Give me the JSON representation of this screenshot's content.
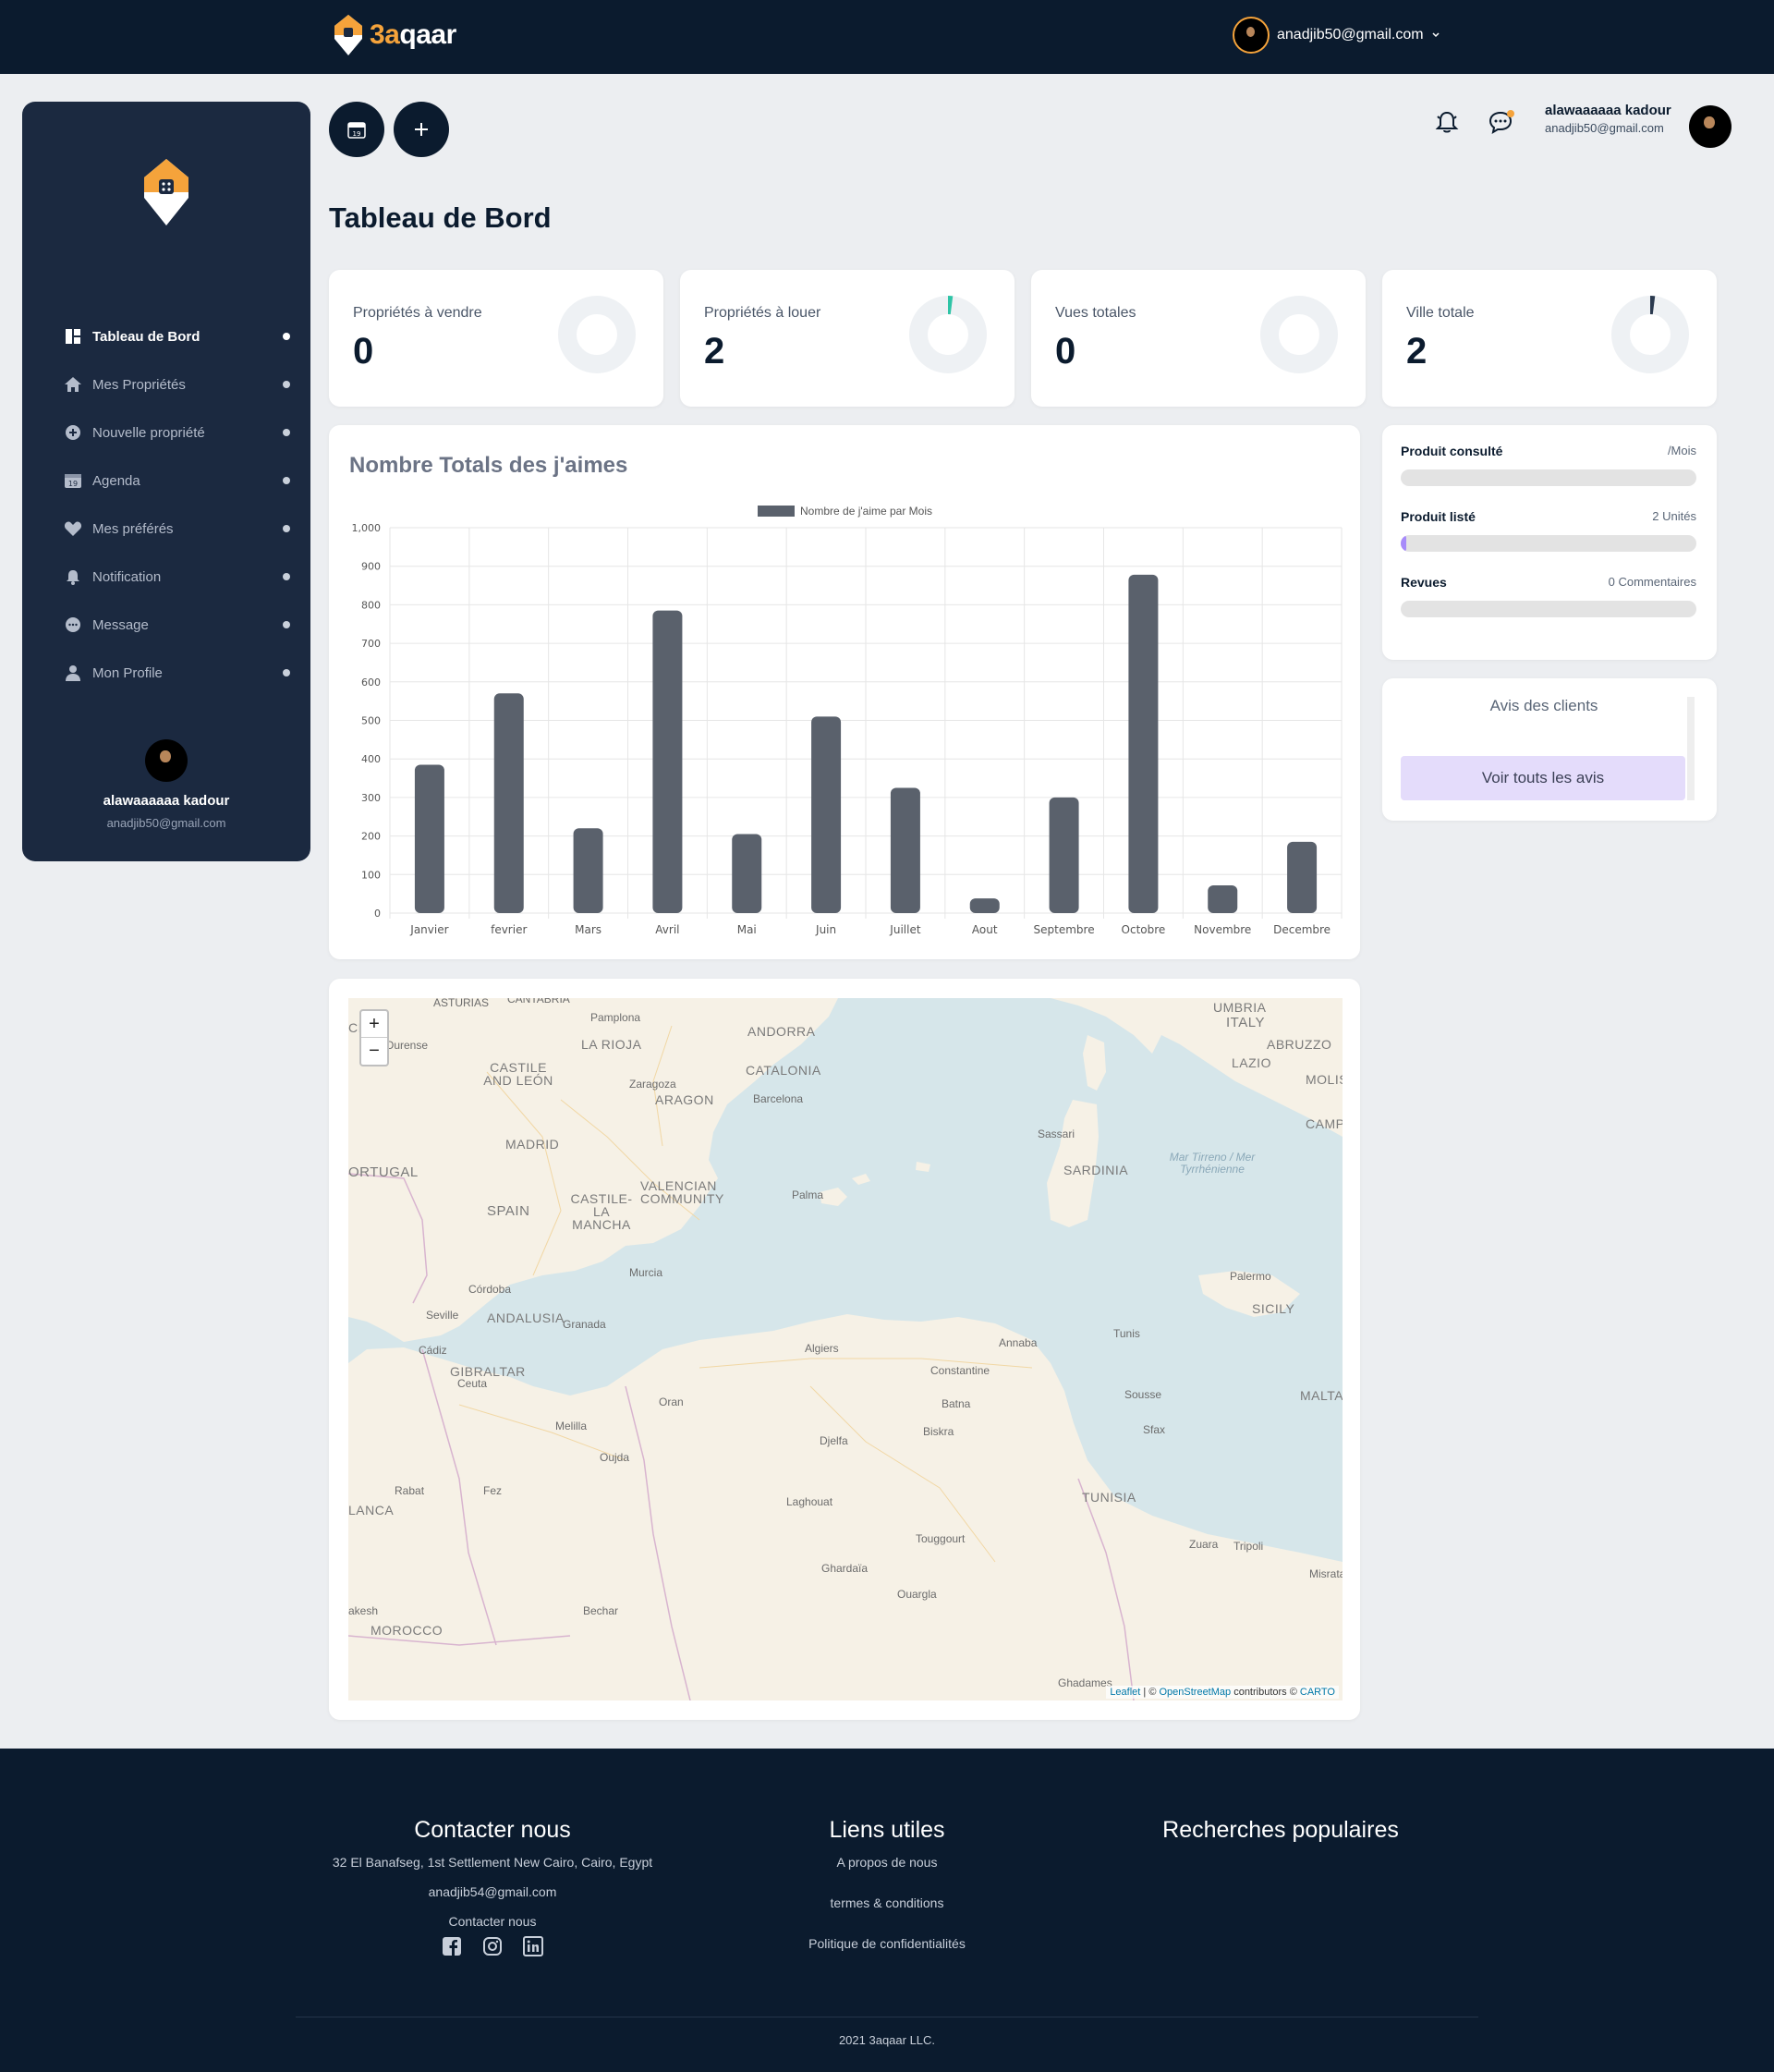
{
  "topnav": {
    "brand_main": "3a",
    "brand_rest": "qaar",
    "user_email": "anadjib50@gmail.com",
    "chevron": "›"
  },
  "sidebar": {
    "items": [
      {
        "label": "Tableau de Bord",
        "icon": "dashboard-icon",
        "active": true
      },
      {
        "label": "Mes Propriétés",
        "icon": "home-icon",
        "active": false
      },
      {
        "label": "Nouvelle propriété",
        "icon": "plus-circle-icon",
        "active": false
      },
      {
        "label": "Agenda",
        "icon": "calendar-icon",
        "active": false
      },
      {
        "label": "Mes préférés",
        "icon": "heart-icon",
        "active": false
      },
      {
        "label": "Notification",
        "icon": "bell-icon",
        "active": false
      },
      {
        "label": "Message",
        "icon": "chat-icon",
        "active": false
      },
      {
        "label": "Mon Profile",
        "icon": "user-icon",
        "active": false
      }
    ],
    "user_name": "alawaaaaaa kadour",
    "user_email": "anadjib50@gmail.com"
  },
  "header": {
    "calendar_day": "19",
    "user_name": "alawaaaaaa kadour",
    "user_email": "anadjib50@gmail.com"
  },
  "page": {
    "title": "Tableau de Bord"
  },
  "stats": [
    {
      "label": "Propriétés à vendre",
      "value": "0",
      "fraction": 0,
      "color": "#2ec4a6"
    },
    {
      "label": "Propriétés à louer",
      "value": "2",
      "fraction": 0.02,
      "color": "#2ec4a6"
    },
    {
      "label": "Vues totales",
      "value": "0",
      "fraction": 0,
      "color": "#2b3a4f"
    },
    {
      "label": "Ville totale",
      "value": "2",
      "fraction": 0.02,
      "color": "#2b3a4f"
    }
  ],
  "chart_data": {
    "type": "bar",
    "title": "Nombre Totals des j'aimes",
    "categories": [
      "Janvier",
      "fevrier",
      "Mars",
      "Avril",
      "Mai",
      "Juin",
      "Juillet",
      "Aout",
      "Septembre",
      "Octobre",
      "Novembre",
      "Decembre"
    ],
    "series": [
      {
        "name": "Nombre de j'aime par Mois",
        "values": [
          385,
          570,
          220,
          785,
          205,
          510,
          325,
          38,
          300,
          878,
          72,
          185
        ],
        "color": "#5a616c"
      }
    ],
    "ylim": [
      0,
      1000
    ],
    "yticks": [
      "0",
      "100",
      "200",
      "300",
      "400",
      "500",
      "600",
      "700",
      "800",
      "900",
      "1,000"
    ],
    "grid": true,
    "legend": "top"
  },
  "progress": [
    {
      "name": "Produit consulté",
      "value_label": "/Mois",
      "fraction": 0
    },
    {
      "name": "Produit listé",
      "value_label": "2 Unités",
      "fraction": 0.02
    },
    {
      "name": "Revues",
      "value_label": "0 Commentaires",
      "fraction": 0
    }
  ],
  "reviews": {
    "title": "Avis des clients",
    "button": "Voir touts les avis"
  },
  "map": {
    "zoom_in": "+",
    "zoom_out": "−",
    "attribution": {
      "leaflet": "Leaflet",
      "sep": " | © ",
      "osm": "OpenStreetMap",
      "contrib": " contributors © ",
      "carto": "CARTO"
    },
    "labels": {
      "asturias": "ASTURIAS",
      "cantabria": "CANTABRIA",
      "pamplona": "Pamplona",
      "andorra": "ANDORRA",
      "larioja": "LA RIOJA",
      "cia": "CIA",
      "ourense": "Ourense",
      "castile": "CASTILE AND LEÓN",
      "zaragoza": "Zaragoza",
      "aragon": "ARAGON",
      "catalonia": "CATALONIA",
      "barcelona": "Barcelona",
      "madrid": "MADRID",
      "ortugal": "ORTUGAL",
      "valencian": "VALENCIAN COMMUNITY",
      "castilelm": "CASTILE-LA MANCHA",
      "spain": "SPAIN",
      "palma": "Palma",
      "murcia": "Murcia",
      "cordoba": "Córdoba",
      "seville": "Seville",
      "andalusia": "ANDALUSIA",
      "granada": "Granada",
      "cadiz": "Cádiz",
      "gibraltar": "GIBRALTAR",
      "ceuta": "Ceuta",
      "melilla": "Melilla",
      "oran": "Oran",
      "oujda": "Oujda",
      "rabat": "Rabat",
      "fez": "Fez",
      "lanca": "LANCA",
      "akesh": "akesh",
      "morocco": "MOROCCO",
      "algiers": "Algiers",
      "annaba": "Annaba",
      "constantine": "Constantine",
      "batna": "Batna",
      "biskra": "Biskra",
      "djelfa": "Djelfa",
      "laghouat": "Laghouat",
      "touggourt": "Touggourt",
      "ghardaia": "Ghardaïa",
      "ouargla": "Ouargla",
      "bechar": "Bechar",
      "ghadames": "Ghadames",
      "tunis": "Tunis",
      "sousse": "Sousse",
      "sfax": "Sfax",
      "tunisia": "TUNISIA",
      "zuara": "Zuara",
      "tripoli": "Tripoli",
      "misrata": "Misrata",
      "malta": "MALTA",
      "sicily": "SICILY",
      "palermo": "Palermo",
      "sardinia": "SARDINIA",
      "sassari": "Sassari",
      "umbria": "UMBRIA",
      "italy": "ITALY",
      "abruzzo": "ABRUZZO",
      "lazio": "LAZIO",
      "molis": "MOLIS",
      "campa": "CAMPA",
      "tyrrhenian": "Mar Tirreno / Mer Tyrrhénienne"
    }
  },
  "footer": {
    "contact_title": "Contacter nous",
    "address": "32 El Banafseg, 1st Settlement New Cairo, Cairo, Egypt",
    "email": "anadjib54@gmail.com",
    "contact_link": "Contacter nous",
    "links_title": "Liens utiles",
    "links": [
      "A propos de nous",
      "termes & conditions",
      "Politique de confidentialités"
    ],
    "popular_title": "Recherches populaires",
    "copyright": "2021 3aqaar LLC."
  },
  "colors": {
    "navy": "#0b1b2e",
    "sidebar": "#1b2940",
    "accent": "#f5a33b",
    "bar": "#5a616c",
    "progress": "#a78bfa",
    "button_bg": "#e4dcfb"
  }
}
